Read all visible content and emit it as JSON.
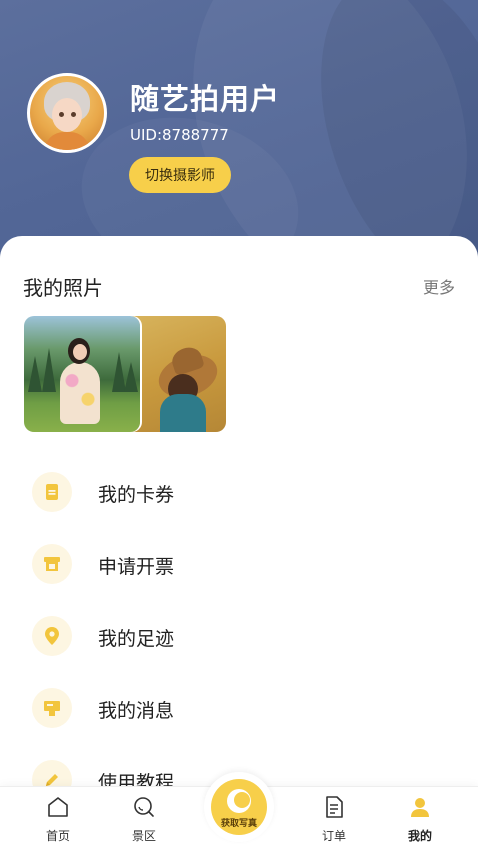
{
  "profile": {
    "username": "随艺拍用户",
    "uid": "UID:8788777",
    "switch_label": "切换摄影师"
  },
  "photos_section": {
    "title": "我的照片",
    "more": "更多"
  },
  "menu": [
    {
      "label": "我的卡券",
      "icon": "coupon-icon"
    },
    {
      "label": "申请开票",
      "icon": "invoice-icon"
    },
    {
      "label": "我的足迹",
      "icon": "location-pin-icon"
    },
    {
      "label": "我的消息",
      "icon": "message-icon"
    },
    {
      "label": "使用教程",
      "icon": "pencil-icon"
    }
  ],
  "tabbar": {
    "home": "首页",
    "scenic": "景区",
    "center": "获取写真",
    "orders": "订单",
    "mine": "我的"
  },
  "colors": {
    "header_bg": "#536797",
    "accent_yellow": "#f7cf4a",
    "icon_bg": "#fdf6e2"
  }
}
